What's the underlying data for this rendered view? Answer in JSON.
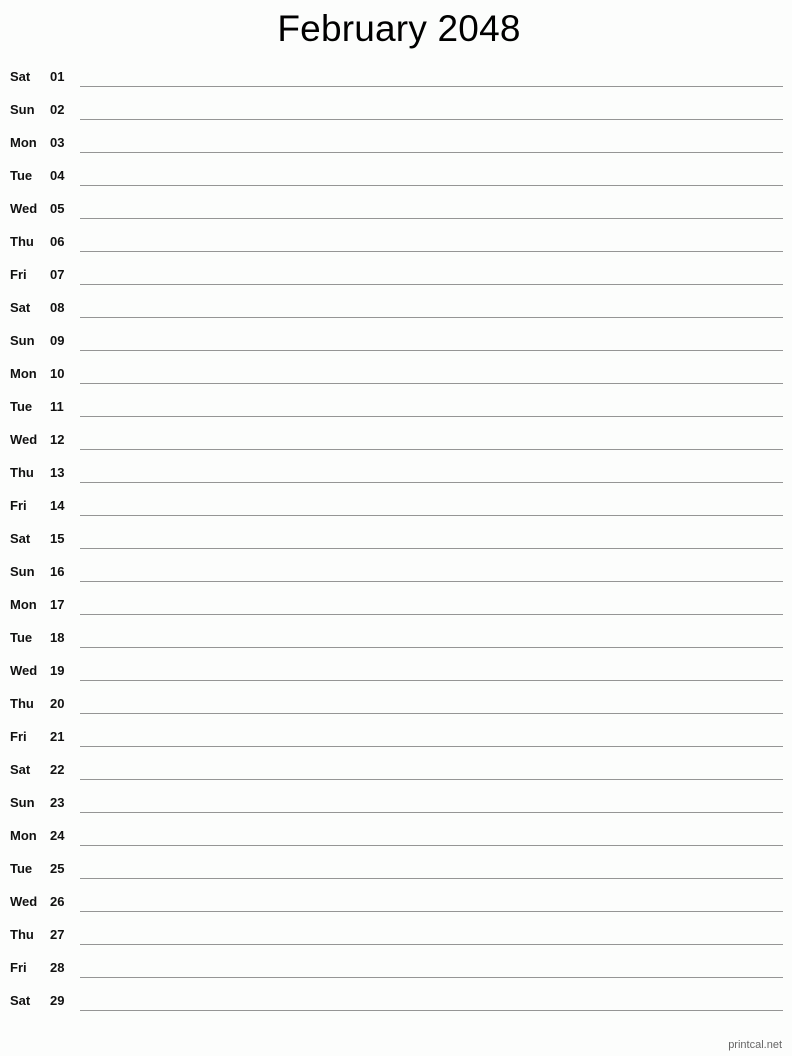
{
  "title": "February 2048",
  "days": [
    {
      "dow": "Sat",
      "day": "01"
    },
    {
      "dow": "Sun",
      "day": "02"
    },
    {
      "dow": "Mon",
      "day": "03"
    },
    {
      "dow": "Tue",
      "day": "04"
    },
    {
      "dow": "Wed",
      "day": "05"
    },
    {
      "dow": "Thu",
      "day": "06"
    },
    {
      "dow": "Fri",
      "day": "07"
    },
    {
      "dow": "Sat",
      "day": "08"
    },
    {
      "dow": "Sun",
      "day": "09"
    },
    {
      "dow": "Mon",
      "day": "10"
    },
    {
      "dow": "Tue",
      "day": "11"
    },
    {
      "dow": "Wed",
      "day": "12"
    },
    {
      "dow": "Thu",
      "day": "13"
    },
    {
      "dow": "Fri",
      "day": "14"
    },
    {
      "dow": "Sat",
      "day": "15"
    },
    {
      "dow": "Sun",
      "day": "16"
    },
    {
      "dow": "Mon",
      "day": "17"
    },
    {
      "dow": "Tue",
      "day": "18"
    },
    {
      "dow": "Wed",
      "day": "19"
    },
    {
      "dow": "Thu",
      "day": "20"
    },
    {
      "dow": "Fri",
      "day": "21"
    },
    {
      "dow": "Sat",
      "day": "22"
    },
    {
      "dow": "Sun",
      "day": "23"
    },
    {
      "dow": "Mon",
      "day": "24"
    },
    {
      "dow": "Tue",
      "day": "25"
    },
    {
      "dow": "Wed",
      "day": "26"
    },
    {
      "dow": "Thu",
      "day": "27"
    },
    {
      "dow": "Fri",
      "day": "28"
    },
    {
      "dow": "Sat",
      "day": "29"
    }
  ],
  "footer": "printcal.net"
}
